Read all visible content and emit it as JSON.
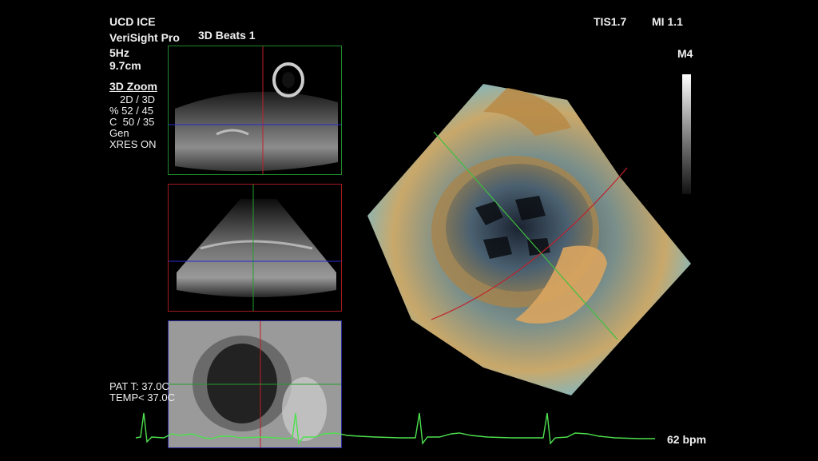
{
  "header": {
    "system": "UCD ICE",
    "probe": "VeriSight Pro",
    "frequency": "5Hz",
    "depth": "9.7cm",
    "mode_title": "3D Beats 1",
    "tis": "TIS1.7",
    "mi": "MI 1.1"
  },
  "params": {
    "section_title": "3D Zoom",
    "lines": [
      "2D / 3D",
      "% 52 / 45",
      "C  50 / 35",
      "Gen",
      "XRES ON"
    ]
  },
  "grayscale": {
    "map_label": "M4"
  },
  "patient": {
    "pat_temp": "PAT T: 37.0C",
    "temp": "TEMP< 37.0C"
  },
  "ecg": {
    "heart_rate": "62 bpm",
    "color": "#4ee04e"
  },
  "panes": [
    {
      "name": "upper",
      "border": "#1f8a2a",
      "vline": "#c0202a",
      "hline": "#2a2ad0"
    },
    {
      "name": "middle",
      "border": "#a01a22",
      "vline": "#22a02a",
      "hline": "#2a2ad0"
    },
    {
      "name": "lower",
      "border": "#2a2a9a",
      "vline": "#c0202a",
      "hline": "#22a02a"
    }
  ]
}
